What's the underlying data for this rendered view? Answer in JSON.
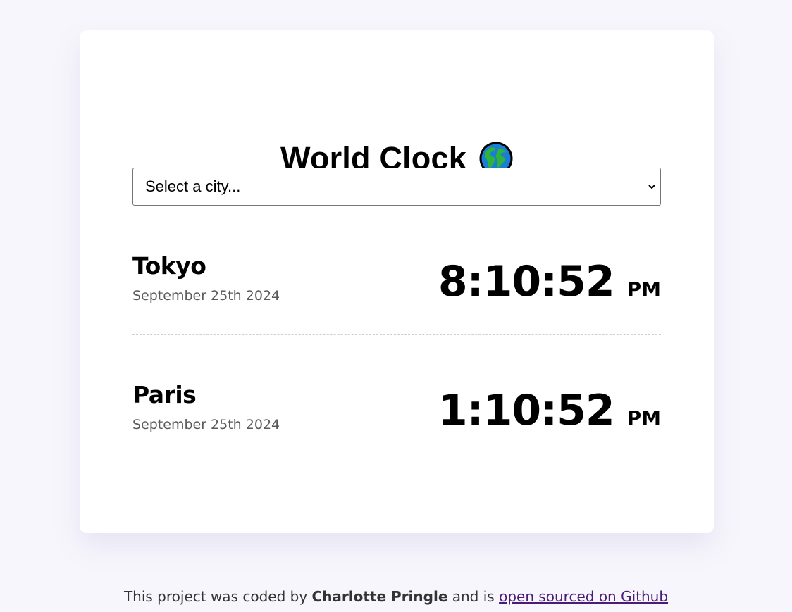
{
  "title": "World Clock",
  "title_icon": "globe-americas-icon",
  "city_select": {
    "selected": "Select a city..."
  },
  "cities": [
    {
      "name": "Tokyo",
      "date": "September 25th 2024",
      "time": "8:10:52",
      "ampm": "PM"
    },
    {
      "name": "Paris",
      "date": "September 25th 2024",
      "time": "1:10:52",
      "ampm": "PM"
    }
  ],
  "footer": {
    "text_before": "This project was coded by ",
    "author": "Charlotte Pringle",
    "text_middle": " and is ",
    "link_text": "open sourced on Github"
  },
  "colors": {
    "page_background": "#f7f6fc",
    "card_background": "#ffffff",
    "link": "#4b1b7a",
    "date_text": "#5a5a5a"
  }
}
